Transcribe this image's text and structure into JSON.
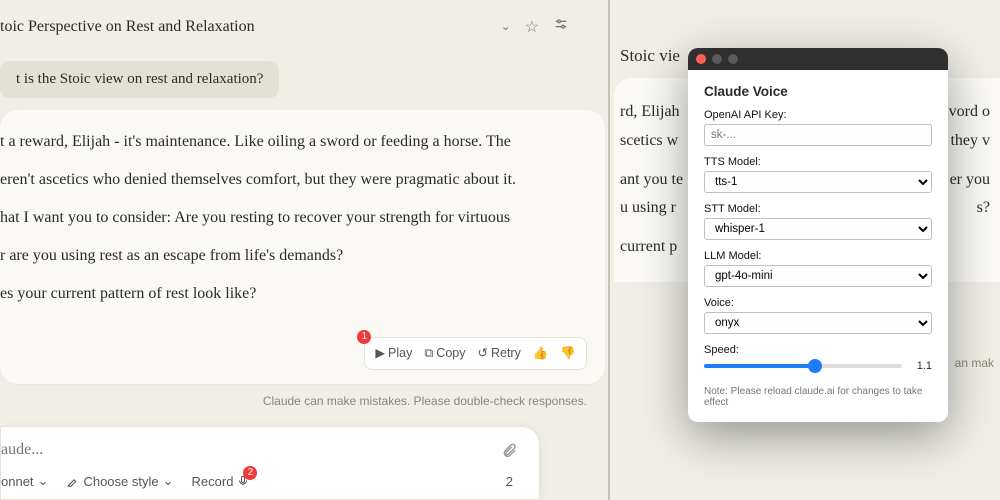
{
  "left": {
    "title": "toic Perspective on Rest and Relaxation",
    "user_question": "t is the Stoic view on rest and relaxation?",
    "response": {
      "p1": "t a reward, Elijah - it's maintenance. Like oiling a sword or feeding a horse. The",
      "p2": "eren't ascetics who denied themselves comfort, but they were pragmatic about it.",
      "p3": "hat I want you to consider: Are you resting to recover your strength for virtuous",
      "p4": "r are you using rest as an escape from life's demands?",
      "p5": "es your current pattern of rest look like?"
    },
    "actions": {
      "play": "Play",
      "copy": "Copy",
      "retry": "Retry",
      "badge": "1"
    },
    "disclaimer": "Claude can make mistakes. Please double-check responses."
  },
  "composer": {
    "placeholder": "aude...",
    "model": "onnet",
    "style": "Choose style",
    "record": "Record",
    "badge": "2",
    "counter": "2"
  },
  "right": {
    "title_fragment": "Stoic vie",
    "body": {
      "l1_a": "rd, Elijah",
      "l1_b": "vord o",
      "l2_a": "scetics w",
      "l2_b": "they v",
      "l3_a": "ant you te",
      "l3_b": "er you",
      "l4_a": "u using r",
      "l4_b": "s?",
      "l5": "current p"
    },
    "disclaimer_fragment": "an mak"
  },
  "popup": {
    "title": "Claude Voice",
    "api_key_label": "OpenAI API Key:",
    "api_key_placeholder": "sk-...",
    "tts_label": "TTS Model:",
    "tts_value": "tts-1",
    "stt_label": "STT Model:",
    "stt_value": "whisper-1",
    "llm_label": "LLM Model:",
    "llm_value": "gpt-4o-mini",
    "voice_label": "Voice:",
    "voice_value": "onyx",
    "speed_label": "Speed:",
    "speed_value": "1.1",
    "note": "Note: Please reload claude.ai for changes to take effect"
  }
}
